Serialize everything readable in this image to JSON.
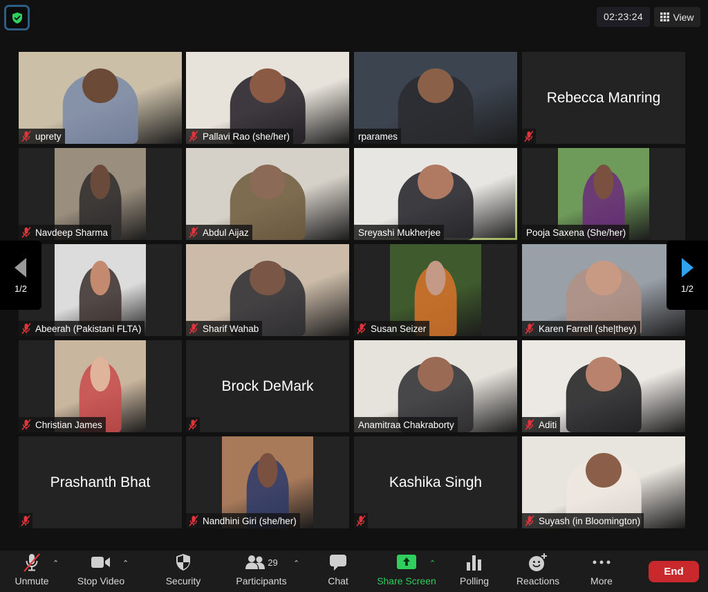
{
  "window": {
    "timer": "02:23:24",
    "view_label": "View",
    "security_status": "encrypted"
  },
  "pager": {
    "prev_label": "1/2",
    "next_label": "1/2"
  },
  "colors": {
    "active_speaker_border": "#c5e06a",
    "share_screen": "#2fce5d",
    "end_button": "#c9282d",
    "muted_icon": "#e0353b",
    "next_arrow": "#2fa3f0",
    "prev_arrow": "#9a9a9a"
  },
  "participants": [
    {
      "name": "uprety",
      "muted": true,
      "video": true,
      "active": false
    },
    {
      "name": "Pallavi Rao (she/her)",
      "muted": true,
      "video": true,
      "active": false
    },
    {
      "name": "rparames",
      "muted": false,
      "video": true,
      "active": false
    },
    {
      "name": "Rebecca Manring",
      "muted": true,
      "video": false,
      "active": false
    },
    {
      "name": "Navdeep Sharma",
      "muted": true,
      "video": true,
      "active": false
    },
    {
      "name": "Abdul Aijaz",
      "muted": true,
      "video": true,
      "active": false
    },
    {
      "name": "Sreyashi Mukherjee",
      "muted": false,
      "video": true,
      "active": true
    },
    {
      "name": "Pooja Saxena (She/her)",
      "muted": false,
      "video": true,
      "active": false
    },
    {
      "name": "Abeerah (Pakistani FLTA)",
      "muted": true,
      "video": true,
      "active": false
    },
    {
      "name": "Sharif Wahab",
      "muted": true,
      "video": true,
      "active": false
    },
    {
      "name": "Susan Seizer",
      "muted": true,
      "video": true,
      "active": false
    },
    {
      "name": "Karen Farrell (she|they)",
      "muted": true,
      "video": true,
      "active": false
    },
    {
      "name": "Christian James",
      "muted": true,
      "video": true,
      "active": false
    },
    {
      "name": "Brock DeMark",
      "muted": true,
      "video": false,
      "active": false
    },
    {
      "name": "Anamitraa Chakraborty",
      "muted": false,
      "video": true,
      "active": false
    },
    {
      "name": "Aditi",
      "muted": true,
      "video": true,
      "active": false
    },
    {
      "name": "Prashanth Bhat",
      "muted": true,
      "video": false,
      "active": false
    },
    {
      "name": "Nandhini Giri (she/her)",
      "muted": true,
      "video": true,
      "active": false
    },
    {
      "name": "Kashika Singh",
      "muted": true,
      "video": false,
      "active": false
    },
    {
      "name": "Suyash (in Bloomington)",
      "muted": true,
      "video": true,
      "active": false
    }
  ],
  "toolbar": {
    "unmute": "Unmute",
    "stop_video": "Stop Video",
    "security": "Security",
    "participants": "Participants",
    "participants_count": "29",
    "chat": "Chat",
    "share_screen": "Share Screen",
    "polling": "Polling",
    "reactions": "Reactions",
    "more": "More",
    "end": "End"
  }
}
